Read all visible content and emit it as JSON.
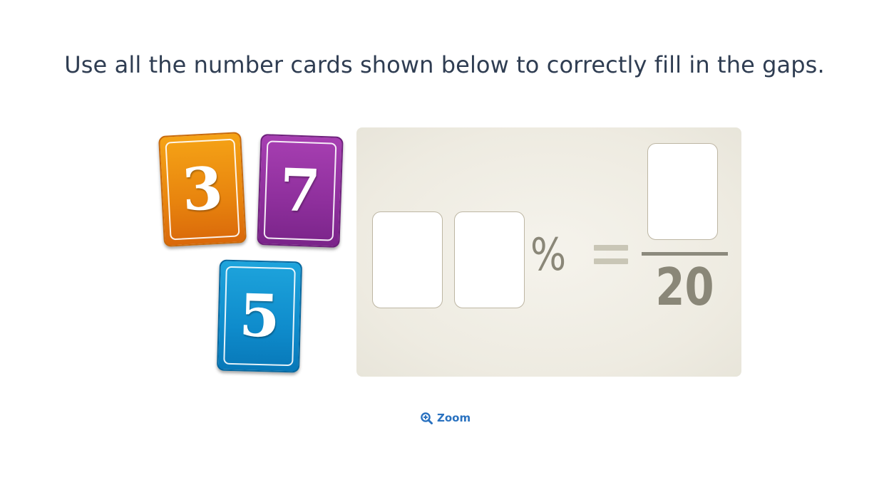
{
  "question": {
    "text": "Use all the number cards shown below to correctly fill in the gaps."
  },
  "cards": [
    {
      "value": "3",
      "color": "#e8840e"
    },
    {
      "value": "7",
      "color": "#8e2f9c"
    },
    {
      "value": "5",
      "color": "#0f8ccc"
    }
  ],
  "equation": {
    "percent_symbol": "%",
    "equals_symbol": "=",
    "denominator": "20"
  },
  "zoom": {
    "label": "Zoom",
    "icon": "zoom-in-icon",
    "color": "#2a72c0"
  }
}
